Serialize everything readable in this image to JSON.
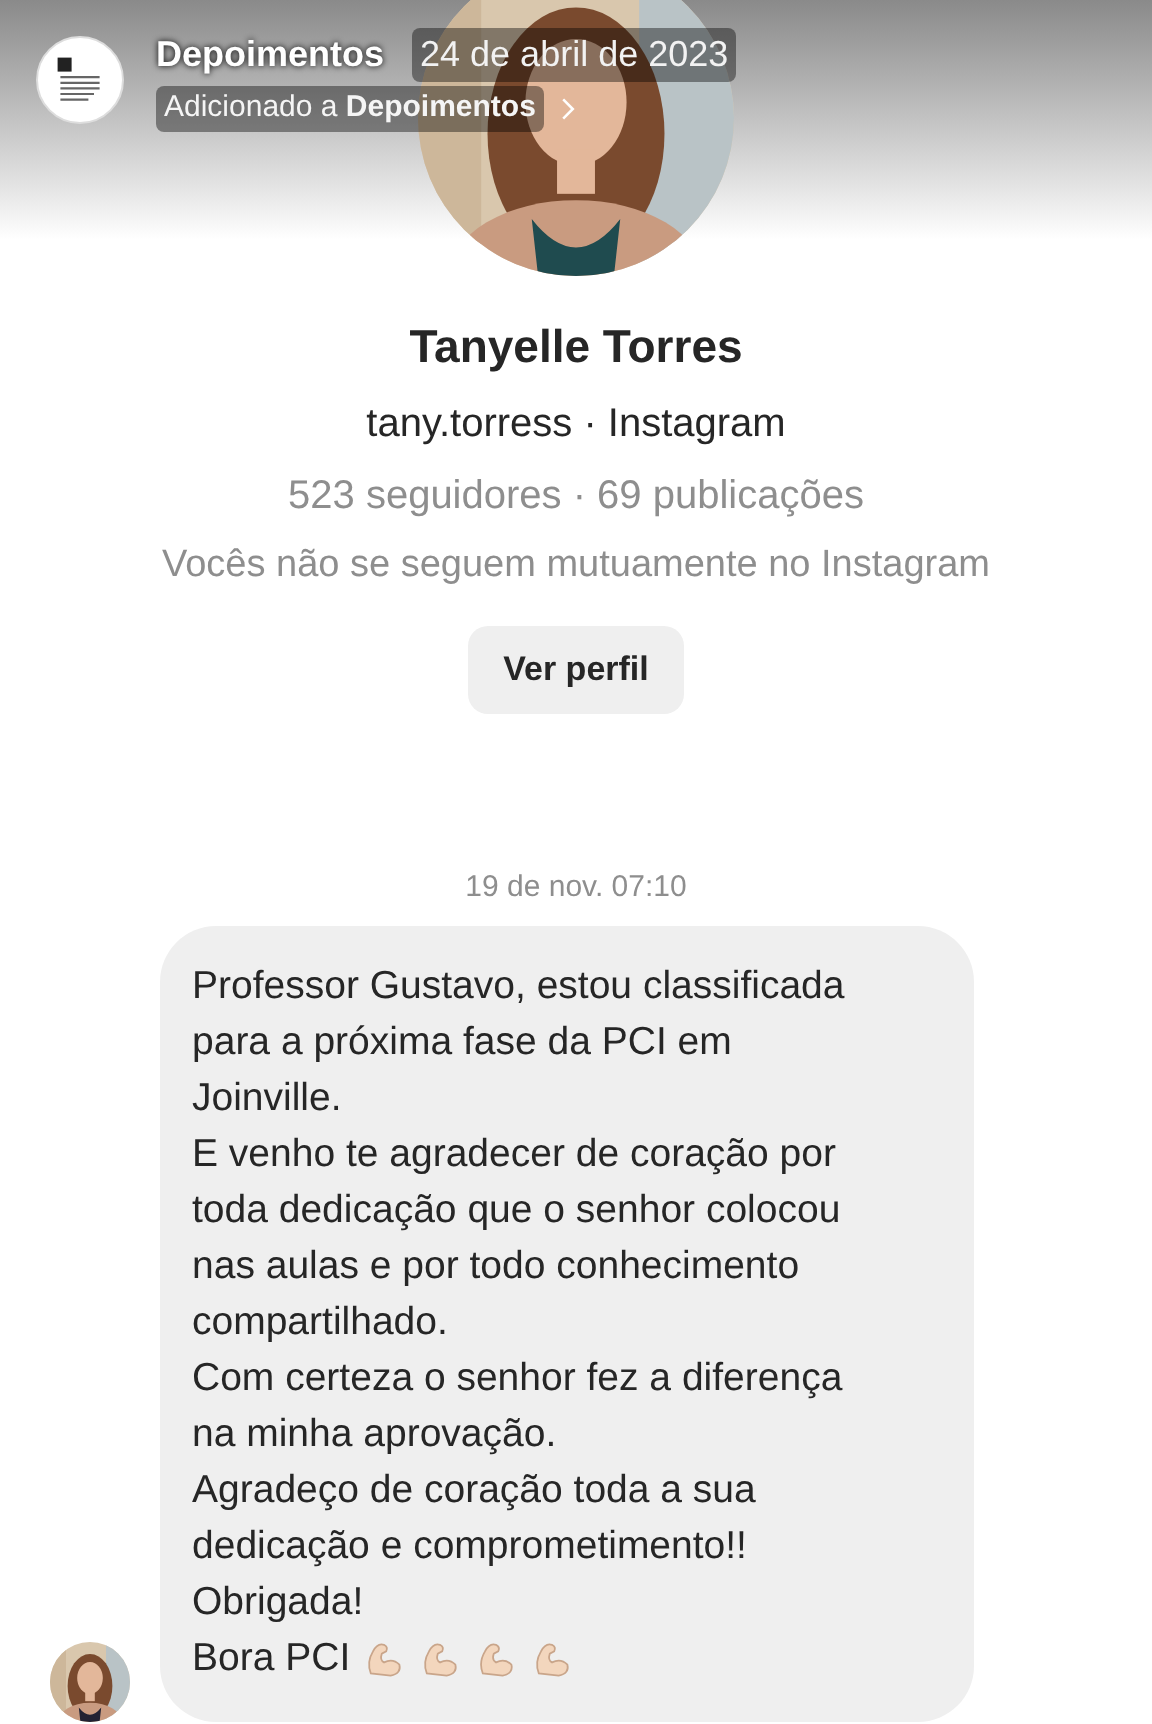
{
  "story_header": {
    "title": "Depoimentos",
    "date": "24 de abril de 2023",
    "added_to": "Adicionado a **Depoimentos**"
  },
  "profile": {
    "name": "Tanyelle Torres",
    "handle": "tany.torress · Instagram",
    "stats": "523 seguidores · 69 publicações",
    "mutual": "Vocês não se seguem mutuamente no Instagram",
    "button": "Ver perfil"
  },
  "timestamp": "19 de nov. 07:10",
  "message": {
    "lines": [
      "Professor Gustavo, estou classificada",
      "para a próxima fase da PCI em",
      "Joinville.",
      "E venho te agradecer de coração por",
      "toda dedicação que o senhor colocou",
      "nas aulas e por todo conhecimento",
      "compartilhado.",
      "Com certeza o senhor fez a diferença",
      "na minha aprovação.",
      "Agradeço de coração toda a sua",
      "dedicação e comprometimento!!",
      "Obrigada!"
    ],
    "last_line": "Bora PCI"
  }
}
